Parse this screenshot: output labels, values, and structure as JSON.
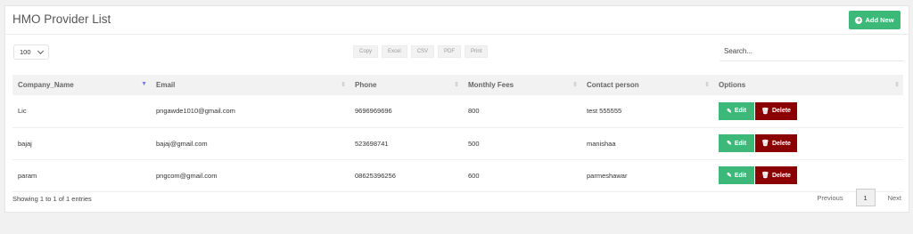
{
  "header": {
    "title": "HMO Provider List",
    "add_label": "Add New"
  },
  "controls": {
    "page_length": "100",
    "export_buttons": [
      "Copy",
      "Excel",
      "CSV",
      "PDF",
      "Print"
    ],
    "search_placeholder": "Search..."
  },
  "table": {
    "columns": [
      "Company_Name",
      "Email",
      "Phone",
      "Monthly Fees",
      "Contact person",
      "Options"
    ],
    "rows": [
      {
        "company": "Lic",
        "email": "pngawde1010@gmail.com",
        "phone": "9696969696",
        "fees": "800",
        "contact": "test 555555"
      },
      {
        "company": "bajaj",
        "email": "bajaj@gmail.com",
        "phone": "523698741",
        "fees": "500",
        "contact": "manishaa"
      },
      {
        "company": "param",
        "email": "pngcom@gmail.com",
        "phone": "08625396256",
        "fees": "600",
        "contact": "parmeshawar"
      }
    ],
    "edit_label": "Edit",
    "delete_label": "Delete"
  },
  "footer": {
    "info": "Showing 1 to 1 of 1 entries",
    "previous_label": "Previous",
    "current_page": "1",
    "next_label": "Next"
  },
  "colors": {
    "accent_green": "#3cb878",
    "delete_red": "#8b0000"
  }
}
